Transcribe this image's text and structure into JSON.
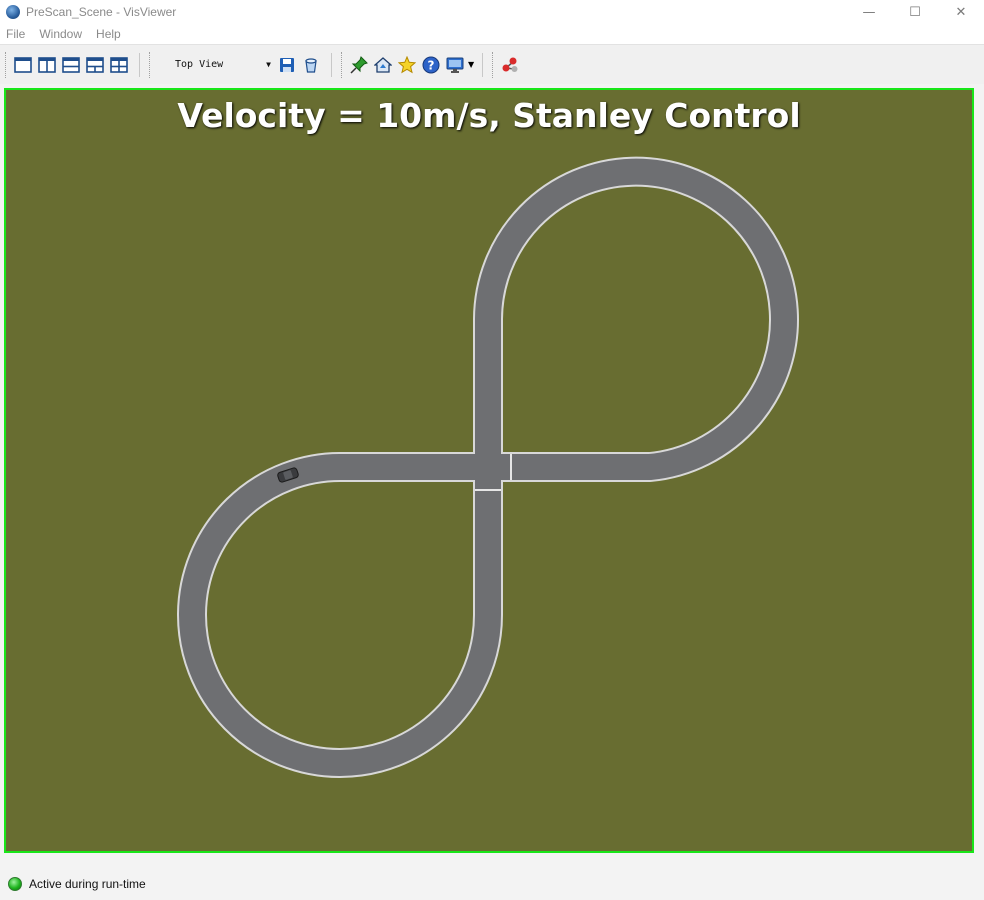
{
  "window": {
    "title": "PreScan_Scene - VisViewer",
    "controls": {
      "minimize": "—",
      "maximize": "☐",
      "close": "✕"
    }
  },
  "menu": [
    "File",
    "Window",
    "Help"
  ],
  "toolbar": {
    "layout_buttons": [
      "single-view-icon",
      "two-vertical-view-icon",
      "two-horizontal-view-icon",
      "three-view-icon",
      "four-view-icon"
    ],
    "view_select": {
      "value": "Top View"
    }
  },
  "viewport": {
    "title": "Velocity = 10m/s, Stanley Control",
    "background_color": "#686d31",
    "border_color": "#19e619",
    "road_color": "#6e6f72",
    "road_edge_color": "#d8d8d8"
  },
  "status": {
    "led_color": "#1fb51f",
    "text": "Active during run-time"
  }
}
